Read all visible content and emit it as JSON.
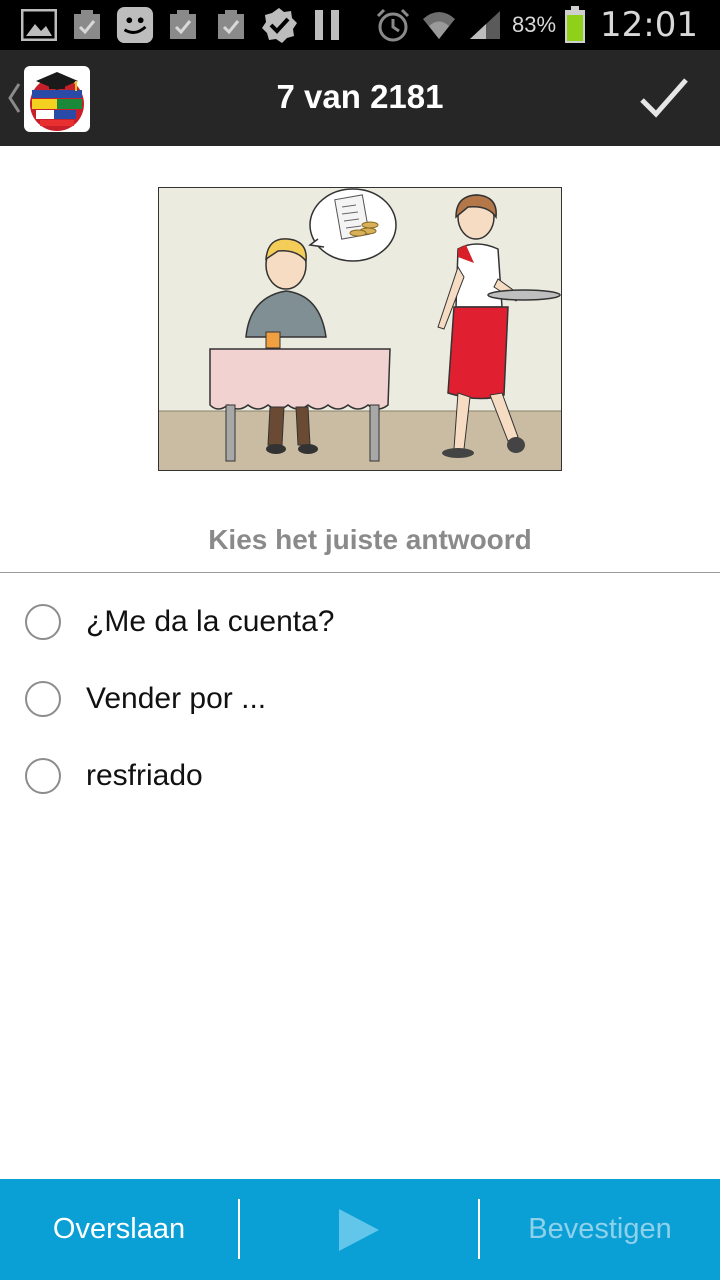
{
  "status_bar": {
    "battery_percent": "83%",
    "time": "12:01",
    "icons": [
      "gallery-icon",
      "task-icon",
      "messenger-icon",
      "task-icon",
      "task-icon",
      "check-badge-icon",
      "pause-icon",
      "alarm-icon",
      "wifi-icon",
      "signal-icon",
      "battery-icon"
    ]
  },
  "action_bar": {
    "title": "7 van 2181",
    "icons": [
      "back-chevron-icon",
      "app-logo",
      "confirm-check-icon"
    ]
  },
  "question": {
    "prompt": "Kies het juiste antwoord",
    "options": [
      {
        "label": "¿Me da la cuenta?",
        "selected": false
      },
      {
        "label": "Vender por ...",
        "selected": false
      },
      {
        "label": "resfriado",
        "selected": false
      }
    ]
  },
  "bottom_bar": {
    "skip_label": "Overslaan",
    "confirm_label": "Bevestigen",
    "play_icon": "play-icon",
    "color": "#0aa0d6"
  }
}
